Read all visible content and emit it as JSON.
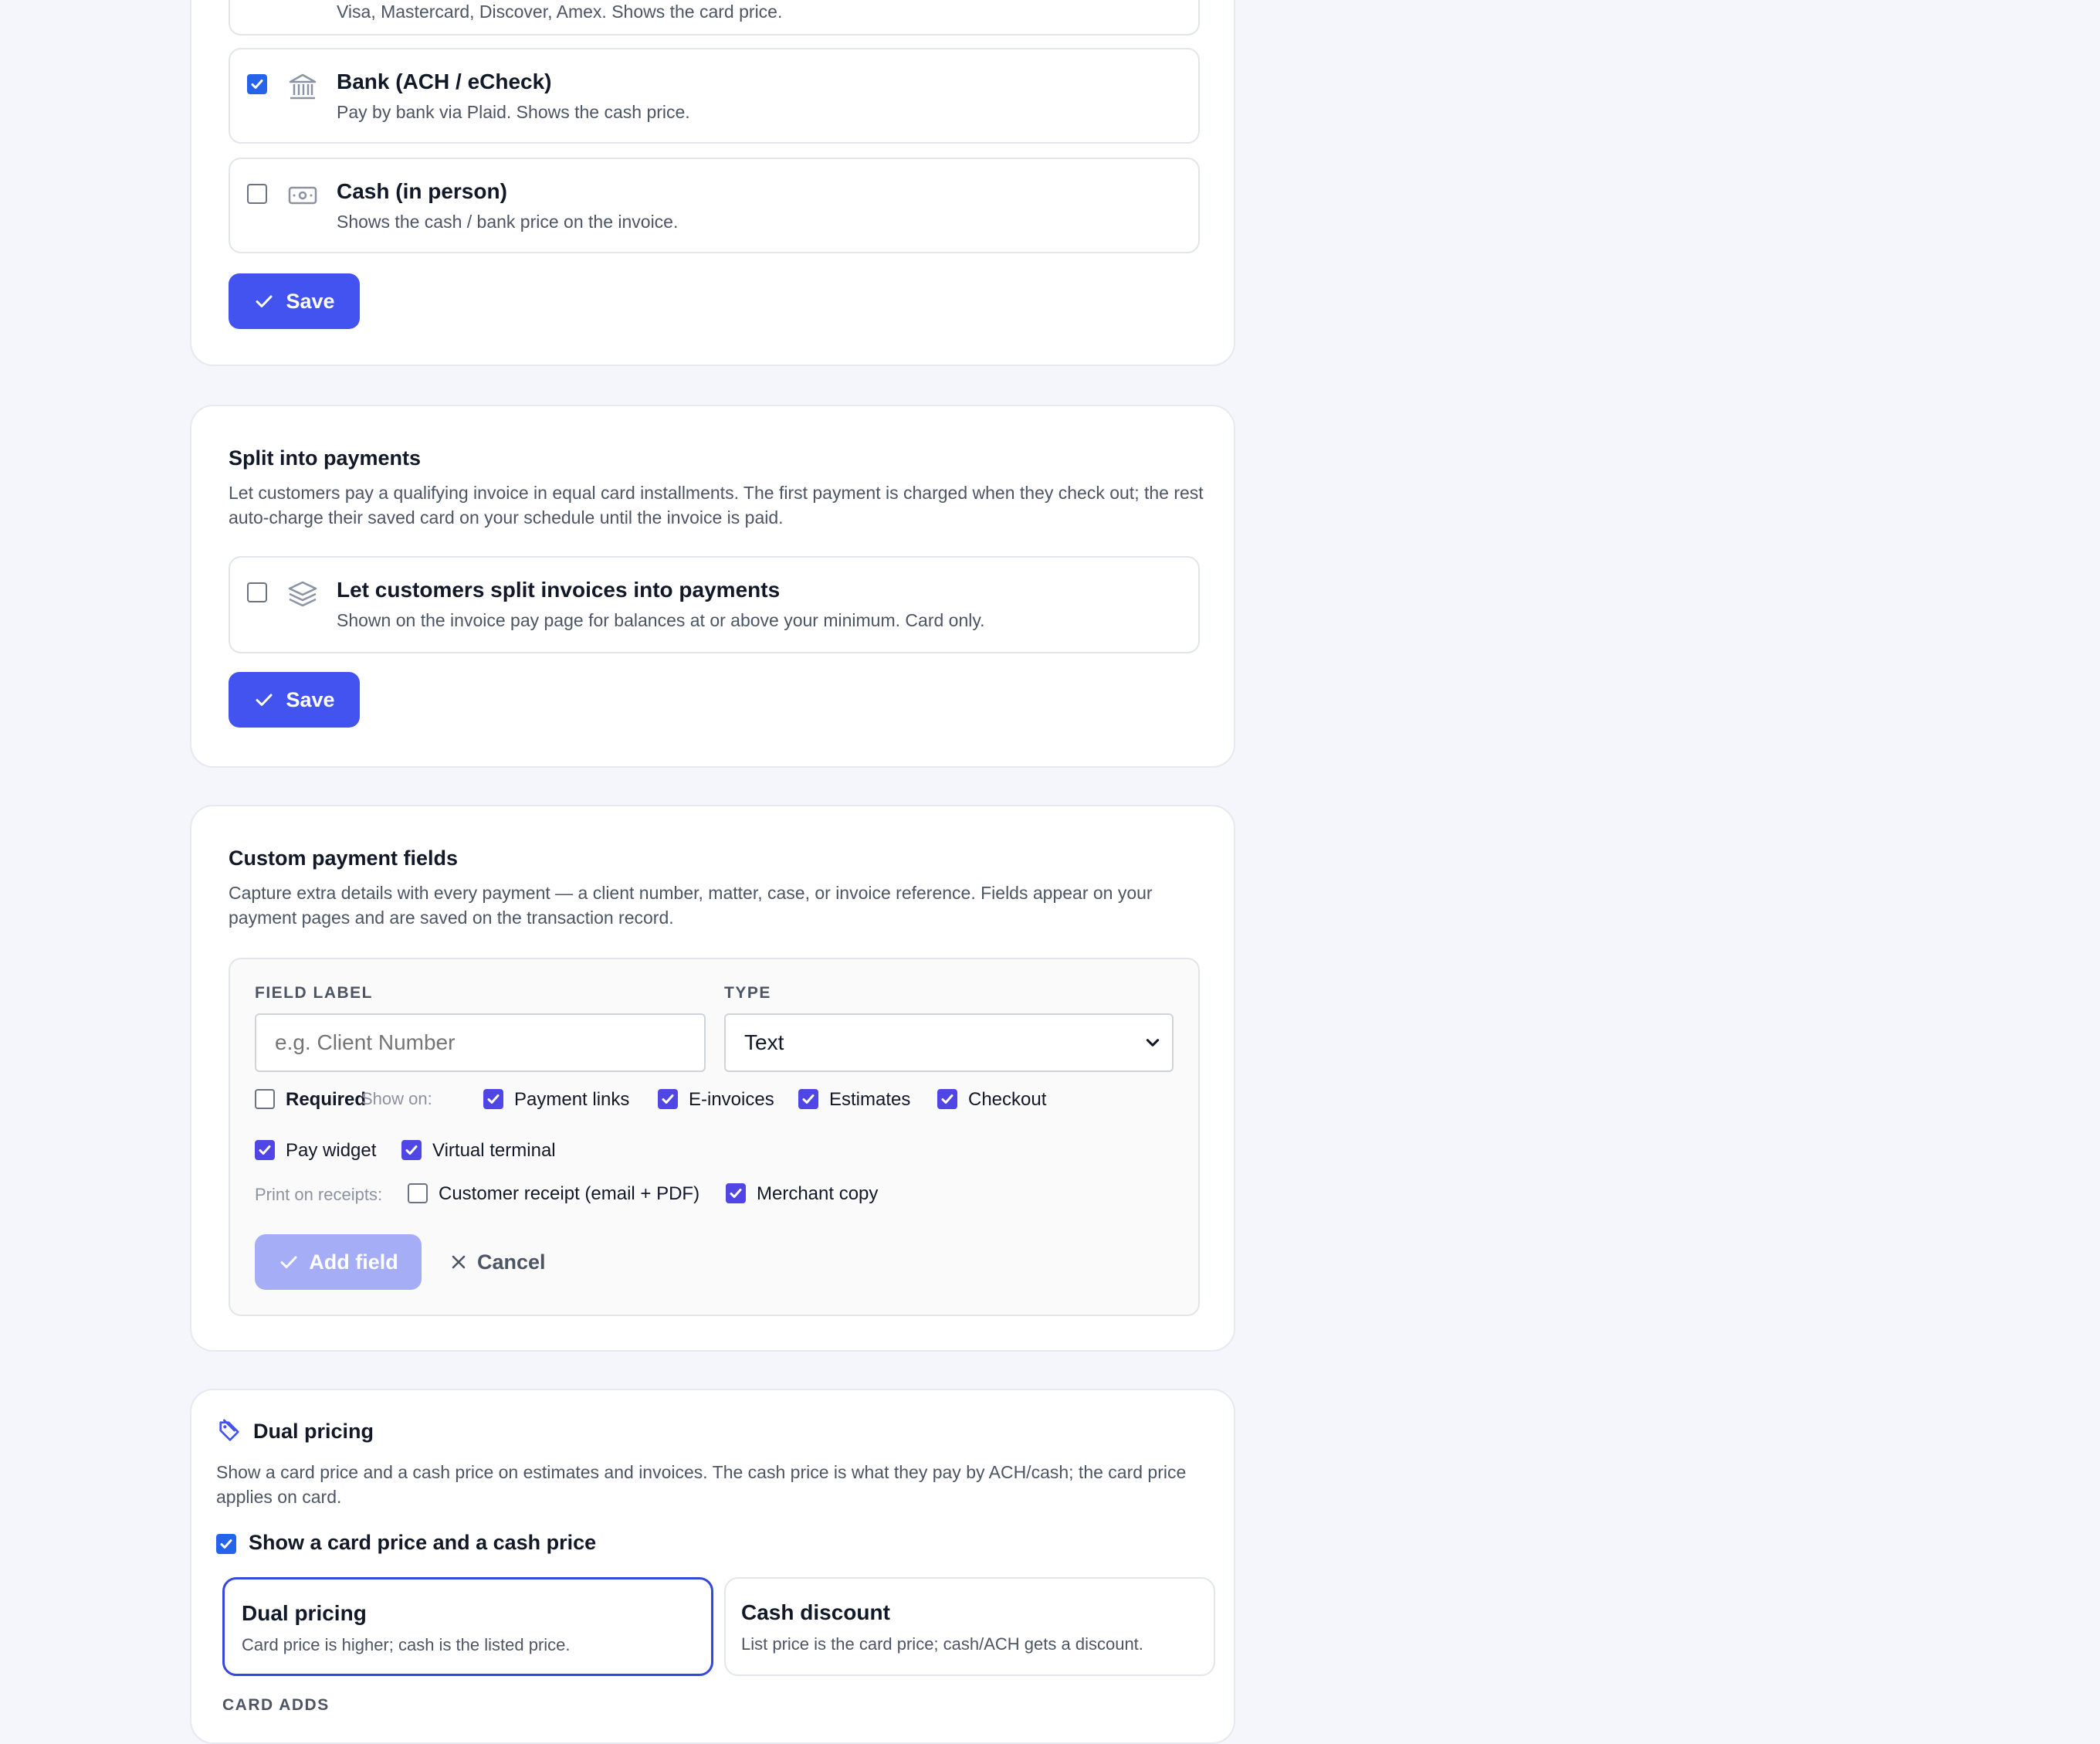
{
  "payment_methods": {
    "card_option_desc_partial": "Visa, Mastercard, Discover, Amex. Shows the card price.",
    "options": [
      {
        "title": "Bank (ACH / eCheck)",
        "desc": "Pay by bank via Plaid. Shows the cash price.",
        "checked": true,
        "icon": "bank-icon"
      },
      {
        "title": "Cash (in person)",
        "desc": "Shows the cash / bank price on the invoice.",
        "checked": false,
        "icon": "cash-icon"
      }
    ],
    "save_label": "Save"
  },
  "split_payments": {
    "title": "Split into payments",
    "desc": "Let customers pay a qualifying invoice in equal card installments. The first payment is charged when they check out; the rest auto-charge their saved card on your schedule until the invoice is paid.",
    "option_title": "Let customers split invoices into payments",
    "option_desc": "Shown on the invoice pay page for balances at or above your minimum. Card only.",
    "option_checked": false,
    "option_icon": "layers-icon",
    "save_label": "Save"
  },
  "custom_fields": {
    "title": "Custom payment fields",
    "desc": "Capture extra details with every payment — a client number, matter, case, or invoice reference. Fields appear on your payment pages and are saved on the transaction record.",
    "field_label_heading": "FIELD LABEL",
    "field_label_placeholder": "e.g. Client Number",
    "type_heading": "TYPE",
    "type_value": "Text",
    "required_label": "Required",
    "required_checked": false,
    "show_on_label": "Show on:",
    "show_on": [
      {
        "label": "Payment links",
        "checked": true
      },
      {
        "label": "E-invoices",
        "checked": true
      },
      {
        "label": "Estimates",
        "checked": true
      },
      {
        "label": "Checkout",
        "checked": true
      },
      {
        "label": "Pay widget",
        "checked": true
      },
      {
        "label": "Virtual terminal",
        "checked": true
      }
    ],
    "print_label": "Print on receipts:",
    "print_on": [
      {
        "label": "Customer receipt (email + PDF)",
        "checked": false
      },
      {
        "label": "Merchant copy",
        "checked": true
      }
    ],
    "add_label": "Add field",
    "cancel_label": "Cancel"
  },
  "dual_pricing": {
    "title": "Dual pricing",
    "desc": "Show a card price and a cash price on estimates and invoices. The cash price is what they pay by ACH/cash; the card price applies on card.",
    "toggle_label": "Show a card price and a cash price",
    "toggle_checked": true,
    "modes": [
      {
        "title": "Dual pricing",
        "desc": "Card price is higher; cash is the listed price.",
        "selected": true
      },
      {
        "title": "Cash discount",
        "desc": "List price is the card price; cash/ACH gets a discount.",
        "selected": false
      }
    ],
    "card_adds_label": "CARD ADDS"
  },
  "colors": {
    "accent": "#4353ef",
    "checkbox_blue": "#2563eb",
    "checkbox_indigo": "#4f46e5",
    "disabled_button": "#a5adf6",
    "selected_border": "#3448e0"
  }
}
